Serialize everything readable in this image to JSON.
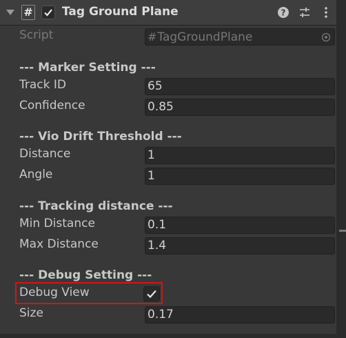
{
  "header": {
    "title": "Tag Ground Plane",
    "script_icon": "#",
    "enabled": true,
    "icons": [
      "foldout-arrow-icon",
      "help-icon",
      "presets-icon",
      "kebab-menu-icon"
    ]
  },
  "script_row": {
    "label": "Script",
    "value": "TagGroundPlane",
    "hash": "#"
  },
  "sections": {
    "marker": "--- Marker Setting ---",
    "vio": "--- Vio Drift Threshold ---",
    "tracking": "--- Tracking distance ---",
    "debug": "--- Debug Setting ---"
  },
  "fields": {
    "track_id": {
      "label": "Track ID",
      "value": "65"
    },
    "confidence": {
      "label": "Confidence",
      "value": "0.85"
    },
    "distance": {
      "label": "Distance",
      "value": "1"
    },
    "angle": {
      "label": "Angle",
      "value": "1"
    },
    "min_distance": {
      "label": "Min Distance",
      "value": "0.1"
    },
    "max_distance": {
      "label": "Max Distance",
      "value": "1.4"
    },
    "debug_view": {
      "label": "Debug View",
      "checked": true
    },
    "size": {
      "label": "Size",
      "value": "0.17"
    }
  },
  "colors": {
    "background": "#383838",
    "field_background": "#2a2a2a",
    "highlight_border": "#d0161c"
  }
}
